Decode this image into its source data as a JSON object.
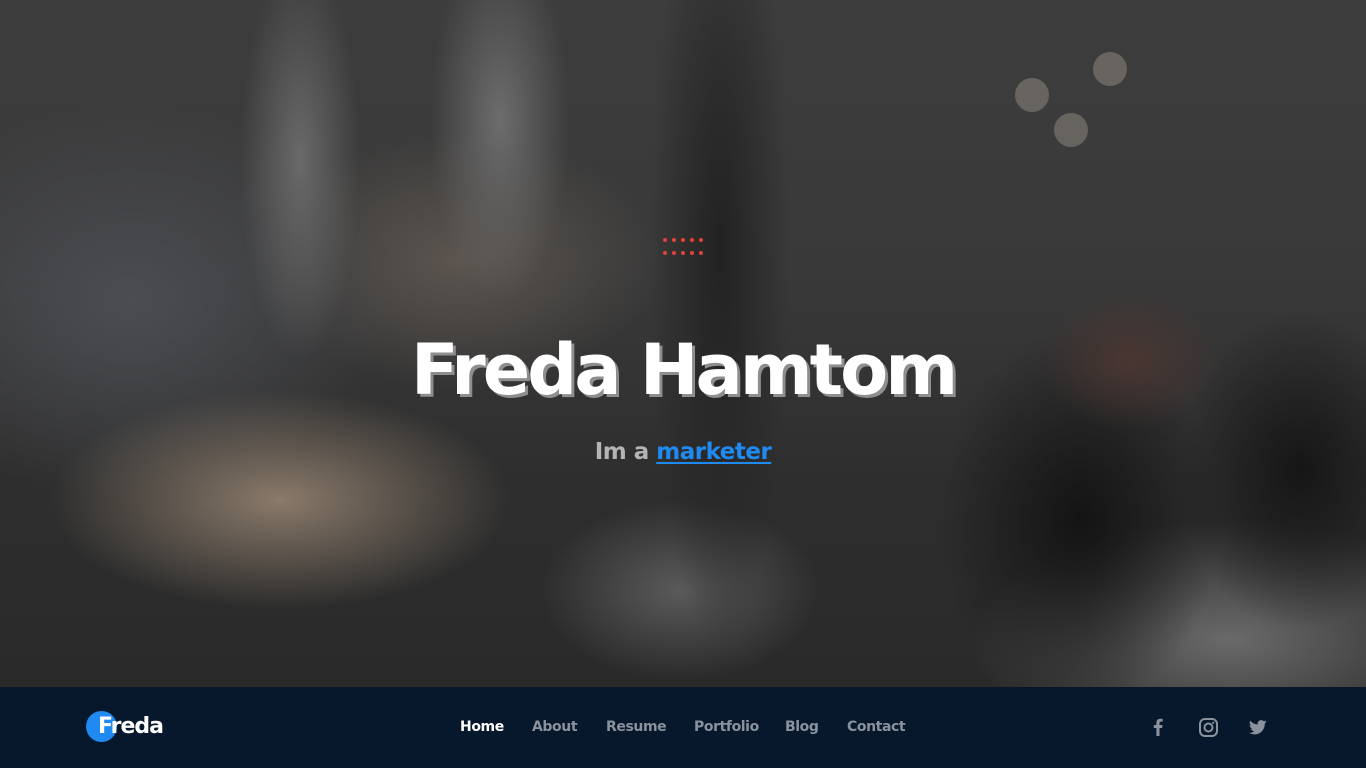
{
  "hero": {
    "name": "Freda Hamtom",
    "subtitle_prefix": "Im a",
    "role": "marketer"
  },
  "nav": {
    "logo_text": "Freda",
    "items": [
      {
        "label": "Home",
        "active": true
      },
      {
        "label": "About",
        "active": false
      },
      {
        "label": "Resume",
        "active": false
      },
      {
        "label": "Portfolio",
        "active": false
      },
      {
        "label": "Blog",
        "active": false
      },
      {
        "label": "Contact",
        "active": false
      }
    ]
  },
  "social": [
    {
      "icon": "facebook-icon"
    },
    {
      "icon": "instagram-icon"
    },
    {
      "icon": "twitter-icon"
    }
  ],
  "colors": {
    "accent": "#1f8af2",
    "dots": "#e1433a",
    "navbar": "#07182c",
    "nav_inactive": "#8a929d"
  }
}
